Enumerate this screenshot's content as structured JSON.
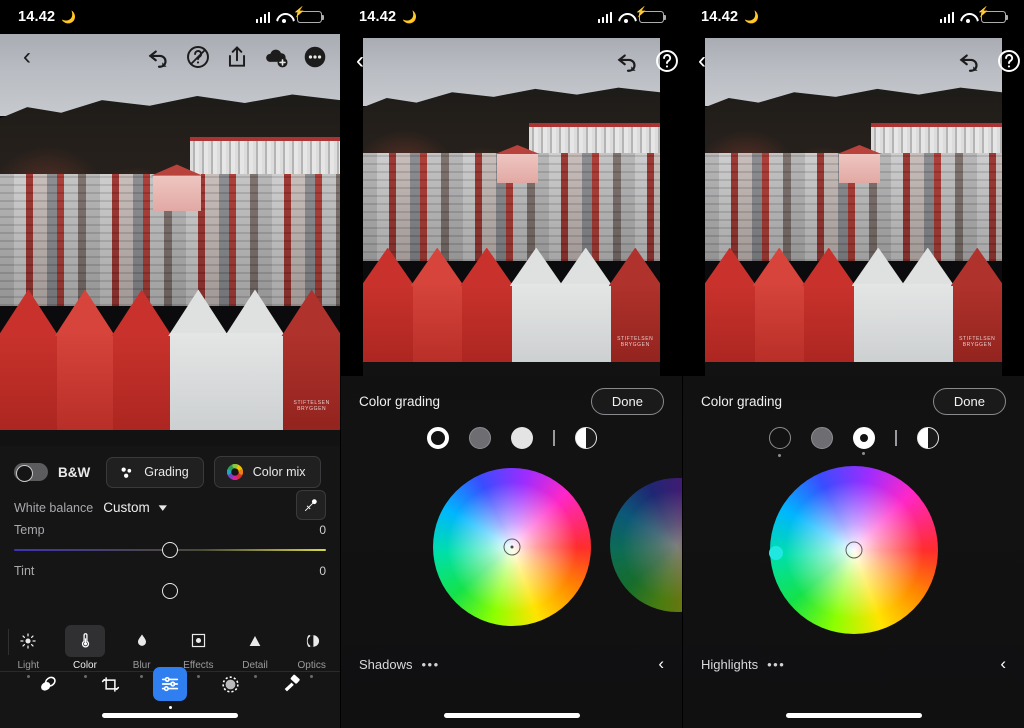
{
  "status": {
    "time": "14.42",
    "moon_icon": "crescent-moon-icon",
    "signal_icon": "cellular-bars-icon",
    "wifi_icon": "wifi-icon",
    "battery_icon": "battery-charging-icon",
    "battery_color": "#2ecc4a"
  },
  "panel1": {
    "nav": {
      "back_icon": "chevron-left-icon",
      "undo_icon": "undo-icon",
      "help_icon": "help-circle-icon",
      "share_icon": "share-upload-icon",
      "cloud_icon": "cloud-add-icon",
      "more_icon": "more-circle-icon"
    },
    "color_panel": {
      "bw_toggle_label": "B&W",
      "bw_toggle_state": "off",
      "grading_label": "Grading",
      "grading_icon": "grading-dots-icon",
      "colormix_label": "Color mix",
      "colormix_icon": "color-wheel-icon",
      "white_balance_label": "White balance",
      "white_balance_value": "Custom",
      "white_balance_chevron": "chevron-down-icon",
      "eyedropper_icon": "eyedropper-icon",
      "sliders": [
        {
          "name": "Temp",
          "value": "0",
          "gradient": "blue-to-yellow"
        },
        {
          "name": "Tint",
          "value": "0",
          "gradient": "green-to-magenta"
        }
      ]
    },
    "tabs": [
      {
        "label": "Light",
        "icon": "sun-icon",
        "selected": false
      },
      {
        "label": "Color",
        "icon": "thermometer-icon",
        "selected": true
      },
      {
        "label": "Blur",
        "icon": "droplet-icon",
        "selected": false
      },
      {
        "label": "Effects",
        "icon": "frame-dot-icon",
        "selected": false
      },
      {
        "label": "Detail",
        "icon": "triangle-icon",
        "selected": false
      },
      {
        "label": "Optics",
        "icon": "lens-icon",
        "selected": false
      }
    ],
    "toolbar": [
      {
        "icon": "presets-icon",
        "active": false
      },
      {
        "icon": "crop-icon",
        "active": false
      },
      {
        "icon": "sliders-icon",
        "active": true
      },
      {
        "icon": "masking-icon",
        "active": false
      },
      {
        "icon": "healing-icon",
        "active": false
      }
    ],
    "accent_color": "#2f7ff0"
  },
  "panel2": {
    "nav": {
      "back_icon": "chevron-left-icon",
      "undo_icon": "undo-icon",
      "help_icon": "help-circle-icon"
    },
    "grading": {
      "title": "Color grading",
      "done_label": "Done",
      "chips": [
        {
          "name": "shadows",
          "selected": true
        },
        {
          "name": "midtones",
          "selected": false
        },
        {
          "name": "highlights",
          "selected": false
        },
        {
          "name": "divider",
          "selected": false
        },
        {
          "name": "blending",
          "selected": false
        }
      ],
      "active_range_label": "Shadows",
      "more_icon": "ellipsis-icon",
      "collapse_icon": "chevron-left-icon",
      "wheel": {
        "hue_marker": "center",
        "saturation": 0
      }
    }
  },
  "panel3": {
    "nav": {
      "back_icon": "chevron-left-icon",
      "undo_icon": "undo-icon",
      "help_icon": "help-circle-icon"
    },
    "grading": {
      "title": "Color grading",
      "done_label": "Done",
      "chips": [
        {
          "name": "shadows",
          "selected": false
        },
        {
          "name": "midtones",
          "selected": false
        },
        {
          "name": "highlights",
          "selected": true
        },
        {
          "name": "divider",
          "selected": false
        },
        {
          "name": "blending",
          "selected": false
        }
      ],
      "active_range_label": "Highlights",
      "more_icon": "ellipsis-icon",
      "collapse_icon": "chevron-left-icon",
      "wheel": {
        "hue_marker": "center",
        "luminance_dot_color": "#20e8e0"
      }
    }
  },
  "photo": {
    "subject": "Bryggen waterfront houses, Bergen",
    "sign_text": "STIFTELSEN BRYGGEN"
  }
}
